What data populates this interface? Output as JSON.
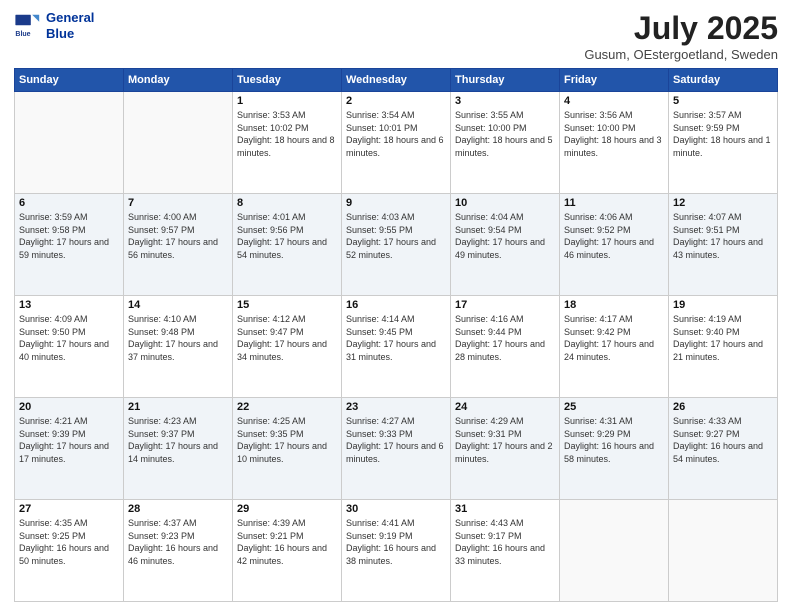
{
  "header": {
    "logo_line1": "General",
    "logo_line2": "Blue",
    "month_title": "July 2025",
    "location": "Gusum, OEstergoetland, Sweden"
  },
  "days_of_week": [
    "Sunday",
    "Monday",
    "Tuesday",
    "Wednesday",
    "Thursday",
    "Friday",
    "Saturday"
  ],
  "weeks": [
    [
      {
        "day": "",
        "info": ""
      },
      {
        "day": "",
        "info": ""
      },
      {
        "day": "1",
        "info": "Sunrise: 3:53 AM\nSunset: 10:02 PM\nDaylight: 18 hours and 8 minutes."
      },
      {
        "day": "2",
        "info": "Sunrise: 3:54 AM\nSunset: 10:01 PM\nDaylight: 18 hours and 6 minutes."
      },
      {
        "day": "3",
        "info": "Sunrise: 3:55 AM\nSunset: 10:00 PM\nDaylight: 18 hours and 5 minutes."
      },
      {
        "day": "4",
        "info": "Sunrise: 3:56 AM\nSunset: 10:00 PM\nDaylight: 18 hours and 3 minutes."
      },
      {
        "day": "5",
        "info": "Sunrise: 3:57 AM\nSunset: 9:59 PM\nDaylight: 18 hours and 1 minute."
      }
    ],
    [
      {
        "day": "6",
        "info": "Sunrise: 3:59 AM\nSunset: 9:58 PM\nDaylight: 17 hours and 59 minutes."
      },
      {
        "day": "7",
        "info": "Sunrise: 4:00 AM\nSunset: 9:57 PM\nDaylight: 17 hours and 56 minutes."
      },
      {
        "day": "8",
        "info": "Sunrise: 4:01 AM\nSunset: 9:56 PM\nDaylight: 17 hours and 54 minutes."
      },
      {
        "day": "9",
        "info": "Sunrise: 4:03 AM\nSunset: 9:55 PM\nDaylight: 17 hours and 52 minutes."
      },
      {
        "day": "10",
        "info": "Sunrise: 4:04 AM\nSunset: 9:54 PM\nDaylight: 17 hours and 49 minutes."
      },
      {
        "day": "11",
        "info": "Sunrise: 4:06 AM\nSunset: 9:52 PM\nDaylight: 17 hours and 46 minutes."
      },
      {
        "day": "12",
        "info": "Sunrise: 4:07 AM\nSunset: 9:51 PM\nDaylight: 17 hours and 43 minutes."
      }
    ],
    [
      {
        "day": "13",
        "info": "Sunrise: 4:09 AM\nSunset: 9:50 PM\nDaylight: 17 hours and 40 minutes."
      },
      {
        "day": "14",
        "info": "Sunrise: 4:10 AM\nSunset: 9:48 PM\nDaylight: 17 hours and 37 minutes."
      },
      {
        "day": "15",
        "info": "Sunrise: 4:12 AM\nSunset: 9:47 PM\nDaylight: 17 hours and 34 minutes."
      },
      {
        "day": "16",
        "info": "Sunrise: 4:14 AM\nSunset: 9:45 PM\nDaylight: 17 hours and 31 minutes."
      },
      {
        "day": "17",
        "info": "Sunrise: 4:16 AM\nSunset: 9:44 PM\nDaylight: 17 hours and 28 minutes."
      },
      {
        "day": "18",
        "info": "Sunrise: 4:17 AM\nSunset: 9:42 PM\nDaylight: 17 hours and 24 minutes."
      },
      {
        "day": "19",
        "info": "Sunrise: 4:19 AM\nSunset: 9:40 PM\nDaylight: 17 hours and 21 minutes."
      }
    ],
    [
      {
        "day": "20",
        "info": "Sunrise: 4:21 AM\nSunset: 9:39 PM\nDaylight: 17 hours and 17 minutes."
      },
      {
        "day": "21",
        "info": "Sunrise: 4:23 AM\nSunset: 9:37 PM\nDaylight: 17 hours and 14 minutes."
      },
      {
        "day": "22",
        "info": "Sunrise: 4:25 AM\nSunset: 9:35 PM\nDaylight: 17 hours and 10 minutes."
      },
      {
        "day": "23",
        "info": "Sunrise: 4:27 AM\nSunset: 9:33 PM\nDaylight: 17 hours and 6 minutes."
      },
      {
        "day": "24",
        "info": "Sunrise: 4:29 AM\nSunset: 9:31 PM\nDaylight: 17 hours and 2 minutes."
      },
      {
        "day": "25",
        "info": "Sunrise: 4:31 AM\nSunset: 9:29 PM\nDaylight: 16 hours and 58 minutes."
      },
      {
        "day": "26",
        "info": "Sunrise: 4:33 AM\nSunset: 9:27 PM\nDaylight: 16 hours and 54 minutes."
      }
    ],
    [
      {
        "day": "27",
        "info": "Sunrise: 4:35 AM\nSunset: 9:25 PM\nDaylight: 16 hours and 50 minutes."
      },
      {
        "day": "28",
        "info": "Sunrise: 4:37 AM\nSunset: 9:23 PM\nDaylight: 16 hours and 46 minutes."
      },
      {
        "day": "29",
        "info": "Sunrise: 4:39 AM\nSunset: 9:21 PM\nDaylight: 16 hours and 42 minutes."
      },
      {
        "day": "30",
        "info": "Sunrise: 4:41 AM\nSunset: 9:19 PM\nDaylight: 16 hours and 38 minutes."
      },
      {
        "day": "31",
        "info": "Sunrise: 4:43 AM\nSunset: 9:17 PM\nDaylight: 16 hours and 33 minutes."
      },
      {
        "day": "",
        "info": ""
      },
      {
        "day": "",
        "info": ""
      }
    ]
  ]
}
